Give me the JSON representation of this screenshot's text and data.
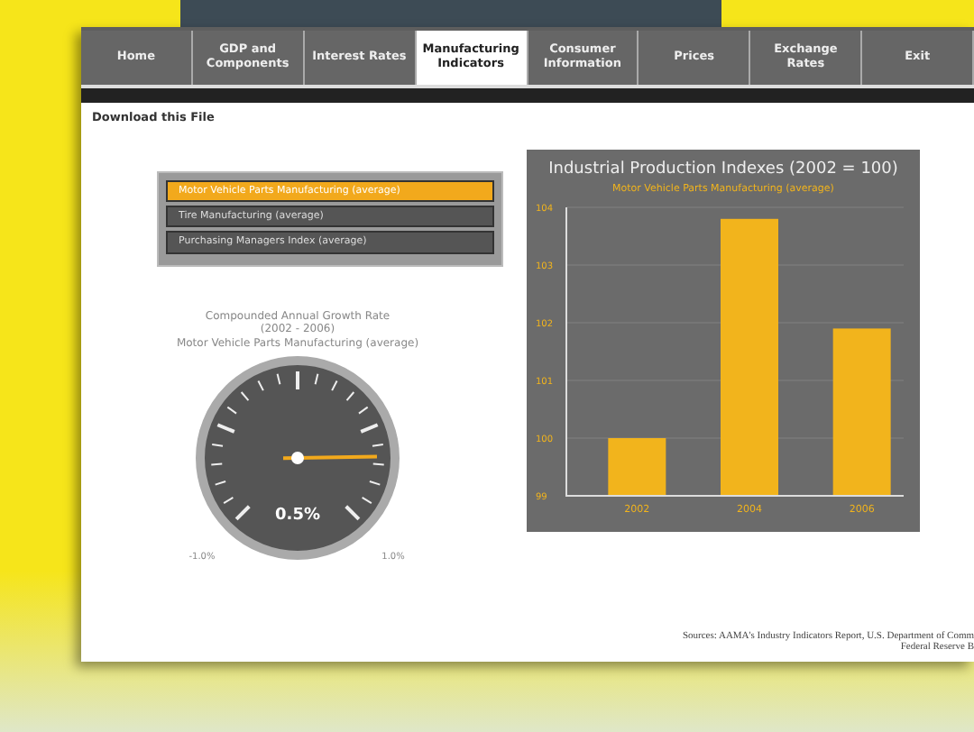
{
  "tabs": [
    {
      "label": "Home",
      "selected": false
    },
    {
      "label": "GDP and Components",
      "selected": false
    },
    {
      "label": "Interest Rates",
      "selected": false
    },
    {
      "label": "Manufacturing Indicators",
      "selected": true
    },
    {
      "label": "Consumer Information",
      "selected": false
    },
    {
      "label": "Prices",
      "selected": false
    },
    {
      "label": "Exchange Rates",
      "selected": false
    },
    {
      "label": "Exit",
      "selected": false
    }
  ],
  "download_link": "Download this File",
  "series_list": [
    {
      "label": "Motor Vehicle Parts Manufacturing (average)",
      "selected": true
    },
    {
      "label": "Tire Manufacturing (average)",
      "selected": false
    },
    {
      "label": "Purchasing Managers Index (average)",
      "selected": false
    }
  ],
  "gauge": {
    "title": "Compounded Annual Growth Rate",
    "period": "(2002 - 2006)",
    "subtitle": "Motor Vehicle Parts Manufacturing (average)",
    "level": 0.83,
    "reading": "0.5%",
    "min_label": "-1.0%",
    "max_label": "1.0%"
  },
  "chart": {
    "chart_data": {
      "type": "bar",
      "title": "Industrial Production Indexes (2002 = 100)",
      "grid": true,
      "categories": [
        "2002",
        "2004",
        "2006"
      ],
      "series": [
        {
          "name": "Motor Vehicle Parts Manufacturing (average)",
          "color": "#f2b41c",
          "values": [
            100,
            103.8,
            101.9
          ]
        }
      ],
      "ylim": [
        99,
        104
      ],
      "yticks": [
        99,
        100,
        101,
        102,
        103,
        104
      ]
    }
  },
  "sources": [
    "Sources: AAMA's Industry Indicators Report, U.S. Department of Comm",
    "Federal Reserve B"
  ]
}
